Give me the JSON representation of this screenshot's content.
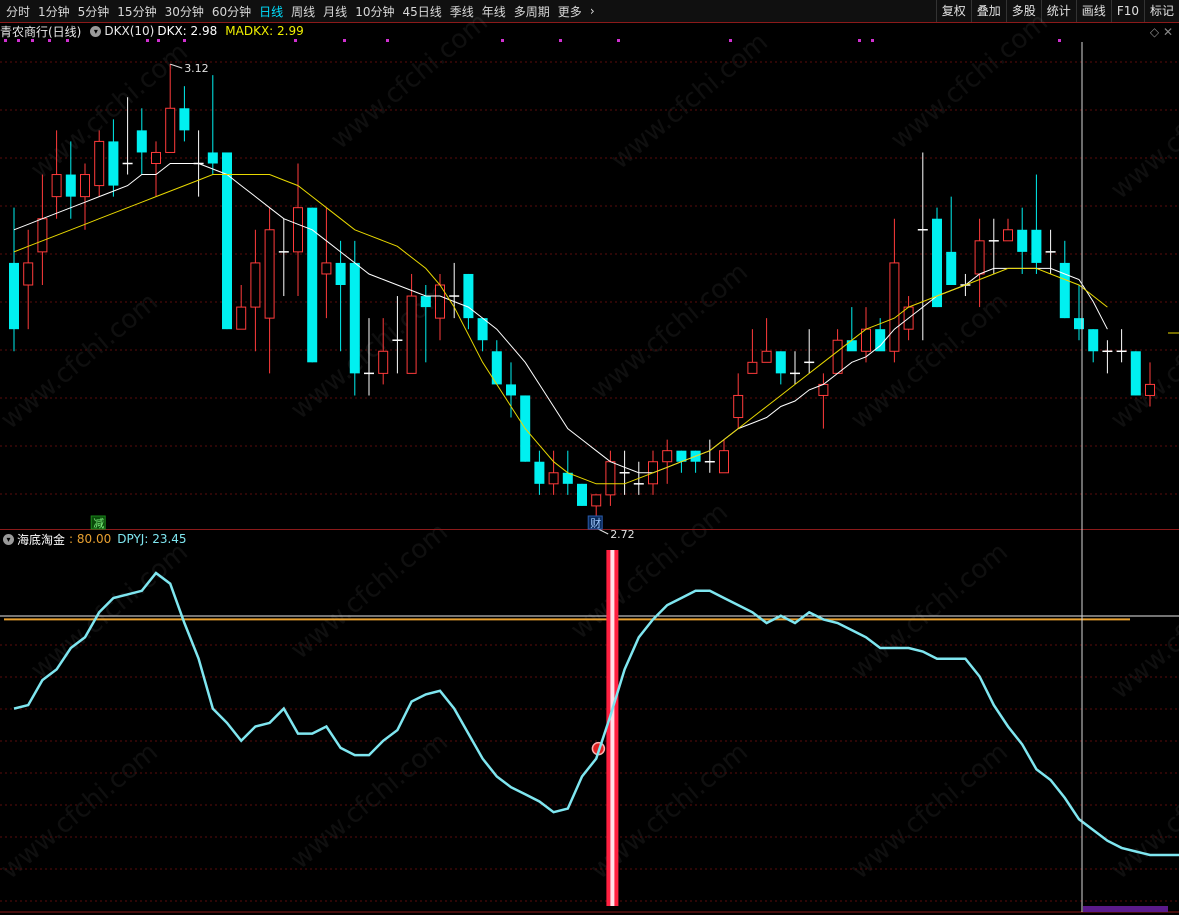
{
  "toolbar": {
    "periods": [
      {
        "label": "分时",
        "active": false
      },
      {
        "label": "1分钟",
        "active": false
      },
      {
        "label": "5分钟",
        "active": false
      },
      {
        "label": "15分钟",
        "active": false
      },
      {
        "label": "30分钟",
        "active": false
      },
      {
        "label": "60分钟",
        "active": false
      },
      {
        "label": "日线",
        "active": true
      },
      {
        "label": "周线",
        "active": false
      },
      {
        "label": "月线",
        "active": false
      },
      {
        "label": "10分钟",
        "active": false
      },
      {
        "label": "45日线",
        "active": false
      },
      {
        "label": "季线",
        "active": false
      },
      {
        "label": "年线",
        "active": false
      },
      {
        "label": "多周期",
        "active": false
      },
      {
        "label": "更多",
        "active": false
      }
    ],
    "more_icon": "chevron-right-icon",
    "right_items": [
      "复权",
      "叠加",
      "多股",
      "统计",
      "画线",
      "F10",
      "标记"
    ]
  },
  "main_panel": {
    "title": "青农商行(日线)",
    "indicator": "DKX(10)",
    "dkx_label": "DKX:",
    "dkx_value": "2.98",
    "madkx_label": "MADKX:",
    "madkx_value": "2.99",
    "high_label": "3.12",
    "low_label": "2.72",
    "marker_jian": "减",
    "marker_cai": "财",
    "colors": {
      "up": "#ff3b3b",
      "down": "#00f0f0",
      "dkx": "#ffffff",
      "madkx": "#e8d800"
    }
  },
  "sub_panel": {
    "title": "海底淘金",
    "level_label": ": 80.00",
    "dpyj_label": "DPYJ:",
    "dpyj_value": "23.45",
    "colors": {
      "line": "#7fe6f0",
      "level": "#e8a030",
      "signal": "#ff2040"
    }
  },
  "watermark": "www.cfchi.com",
  "chart_data": [
    {
      "type": "candlestick",
      "title": "青农商行(日线)",
      "price_range": [
        2.7,
        3.14
      ],
      "candles": [
        {
          "o": 2.94,
          "h": 2.99,
          "l": 2.86,
          "c": 2.88
        },
        {
          "o": 2.92,
          "h": 2.97,
          "l": 2.88,
          "c": 2.94
        },
        {
          "o": 2.95,
          "h": 3.02,
          "l": 2.92,
          "c": 2.98
        },
        {
          "o": 3.0,
          "h": 3.06,
          "l": 2.98,
          "c": 3.02
        },
        {
          "o": 3.02,
          "h": 3.05,
          "l": 2.98,
          "c": 3.0
        },
        {
          "o": 3.0,
          "h": 3.03,
          "l": 2.97,
          "c": 3.02
        },
        {
          "o": 3.01,
          "h": 3.06,
          "l": 3.0,
          "c": 3.05
        },
        {
          "o": 3.05,
          "h": 3.07,
          "l": 3.0,
          "c": 3.01
        },
        {
          "o": 3.03,
          "h": 3.09,
          "l": 3.02,
          "c": 3.03
        },
        {
          "o": 3.06,
          "h": 3.08,
          "l": 3.02,
          "c": 3.04
        },
        {
          "o": 3.03,
          "h": 3.05,
          "l": 3.0,
          "c": 3.04
        },
        {
          "o": 3.04,
          "h": 3.12,
          "l": 3.04,
          "c": 3.08
        },
        {
          "o": 3.08,
          "h": 3.1,
          "l": 3.05,
          "c": 3.06
        },
        {
          "o": 3.03,
          "h": 3.06,
          "l": 3.0,
          "c": 3.03
        },
        {
          "o": 3.04,
          "h": 3.11,
          "l": 3.02,
          "c": 3.03
        },
        {
          "o": 3.04,
          "h": 3.04,
          "l": 2.88,
          "c": 2.88
        },
        {
          "o": 2.88,
          "h": 2.92,
          "l": 2.88,
          "c": 2.9
        },
        {
          "o": 2.9,
          "h": 2.97,
          "l": 2.86,
          "c": 2.94
        },
        {
          "o": 2.89,
          "h": 2.99,
          "l": 2.84,
          "c": 2.97
        },
        {
          "o": 2.95,
          "h": 2.98,
          "l": 2.91,
          "c": 2.95
        },
        {
          "o": 2.95,
          "h": 3.03,
          "l": 2.91,
          "c": 2.99
        },
        {
          "o": 2.99,
          "h": 2.99,
          "l": 2.85,
          "c": 2.85
        },
        {
          "o": 2.93,
          "h": 2.99,
          "l": 2.89,
          "c": 2.94
        },
        {
          "o": 2.94,
          "h": 2.96,
          "l": 2.86,
          "c": 2.92
        },
        {
          "o": 2.94,
          "h": 2.96,
          "l": 2.82,
          "c": 2.84
        },
        {
          "o": 2.84,
          "h": 2.89,
          "l": 2.82,
          "c": 2.84
        },
        {
          "o": 2.84,
          "h": 2.89,
          "l": 2.83,
          "c": 2.86
        },
        {
          "o": 2.87,
          "h": 2.91,
          "l": 2.84,
          "c": 2.87
        },
        {
          "o": 2.84,
          "h": 2.93,
          "l": 2.84,
          "c": 2.91
        },
        {
          "o": 2.91,
          "h": 2.92,
          "l": 2.85,
          "c": 2.9
        },
        {
          "o": 2.89,
          "h": 2.93,
          "l": 2.87,
          "c": 2.92
        },
        {
          "o": 2.91,
          "h": 2.94,
          "l": 2.89,
          "c": 2.91
        },
        {
          "o": 2.93,
          "h": 2.93,
          "l": 2.88,
          "c": 2.89
        },
        {
          "o": 2.89,
          "h": 2.89,
          "l": 2.86,
          "c": 2.87
        },
        {
          "o": 2.86,
          "h": 2.87,
          "l": 2.83,
          "c": 2.83
        },
        {
          "o": 2.83,
          "h": 2.85,
          "l": 2.8,
          "c": 2.82
        },
        {
          "o": 2.82,
          "h": 2.82,
          "l": 2.76,
          "c": 2.76
        },
        {
          "o": 2.76,
          "h": 2.77,
          "l": 2.73,
          "c": 2.74
        },
        {
          "o": 2.74,
          "h": 2.77,
          "l": 2.73,
          "c": 2.75
        },
        {
          "o": 2.75,
          "h": 2.77,
          "l": 2.73,
          "c": 2.74
        },
        {
          "o": 2.74,
          "h": 2.74,
          "l": 2.72,
          "c": 2.72
        },
        {
          "o": 2.72,
          "h": 2.73,
          "l": 2.7,
          "c": 2.73
        },
        {
          "o": 2.73,
          "h": 2.77,
          "l": 2.72,
          "c": 2.76
        },
        {
          "o": 2.75,
          "h": 2.77,
          "l": 2.73,
          "c": 2.75
        },
        {
          "o": 2.74,
          "h": 2.76,
          "l": 2.73,
          "c": 2.74
        },
        {
          "o": 2.74,
          "h": 2.77,
          "l": 2.73,
          "c": 2.76
        },
        {
          "o": 2.76,
          "h": 2.78,
          "l": 2.74,
          "c": 2.77
        },
        {
          "o": 2.77,
          "h": 2.77,
          "l": 2.75,
          "c": 2.76
        },
        {
          "o": 2.77,
          "h": 2.77,
          "l": 2.75,
          "c": 2.76
        },
        {
          "o": 2.76,
          "h": 2.78,
          "l": 2.75,
          "c": 2.76
        },
        {
          "o": 2.75,
          "h": 2.78,
          "l": 2.75,
          "c": 2.77
        },
        {
          "o": 2.8,
          "h": 2.84,
          "l": 2.79,
          "c": 2.82
        },
        {
          "o": 2.84,
          "h": 2.88,
          "l": 2.84,
          "c": 2.85
        },
        {
          "o": 2.85,
          "h": 2.89,
          "l": 2.85,
          "c": 2.86
        },
        {
          "o": 2.86,
          "h": 2.86,
          "l": 2.83,
          "c": 2.84
        },
        {
          "o": 2.84,
          "h": 2.86,
          "l": 2.83,
          "c": 2.84
        },
        {
          "o": 2.85,
          "h": 2.88,
          "l": 2.84,
          "c": 2.85
        },
        {
          "o": 2.82,
          "h": 2.84,
          "l": 2.79,
          "c": 2.83
        },
        {
          "o": 2.84,
          "h": 2.88,
          "l": 2.84,
          "c": 2.87
        },
        {
          "o": 2.87,
          "h": 2.9,
          "l": 2.87,
          "c": 2.86
        },
        {
          "o": 2.86,
          "h": 2.9,
          "l": 2.85,
          "c": 2.88
        },
        {
          "o": 2.88,
          "h": 2.89,
          "l": 2.87,
          "c": 2.86
        },
        {
          "o": 2.86,
          "h": 2.98,
          "l": 2.85,
          "c": 2.94
        },
        {
          "o": 2.88,
          "h": 2.91,
          "l": 2.87,
          "c": 2.9
        },
        {
          "o": 2.97,
          "h": 3.04,
          "l": 2.87,
          "c": 2.97
        },
        {
          "o": 2.98,
          "h": 2.99,
          "l": 2.9,
          "c": 2.9
        },
        {
          "o": 2.95,
          "h": 3.0,
          "l": 2.92,
          "c": 2.92
        },
        {
          "o": 2.92,
          "h": 2.93,
          "l": 2.91,
          "c": 2.92
        },
        {
          "o": 2.93,
          "h": 2.98,
          "l": 2.9,
          "c": 2.96
        },
        {
          "o": 2.96,
          "h": 2.98,
          "l": 2.93,
          "c": 2.96
        },
        {
          "o": 2.96,
          "h": 2.98,
          "l": 2.96,
          "c": 2.97
        },
        {
          "o": 2.97,
          "h": 2.99,
          "l": 2.93,
          "c": 2.95
        },
        {
          "o": 2.97,
          "h": 3.02,
          "l": 2.93,
          "c": 2.94
        },
        {
          "o": 2.95,
          "h": 2.97,
          "l": 2.93,
          "c": 2.95
        },
        {
          "o": 2.94,
          "h": 2.96,
          "l": 2.89,
          "c": 2.89
        },
        {
          "o": 2.89,
          "h": 2.92,
          "l": 2.87,
          "c": 2.88
        },
        {
          "o": 2.88,
          "h": 2.88,
          "l": 2.85,
          "c": 2.86
        },
        {
          "o": 2.86,
          "h": 2.87,
          "l": 2.84,
          "c": 2.86
        },
        {
          "o": 2.86,
          "h": 2.88,
          "l": 2.85,
          "c": 2.86
        },
        {
          "o": 2.86,
          "h": 2.86,
          "l": 2.82,
          "c": 2.82
        },
        {
          "o": 2.82,
          "h": 2.85,
          "l": 2.81,
          "c": 2.83
        }
      ],
      "series": [
        {
          "name": "DKX",
          "values": [
            2.97,
            2.975,
            2.98,
            2.985,
            2.99,
            2.995,
            3.0,
            3.005,
            3.01,
            3.02,
            3.02,
            3.03,
            3.03,
            3.03,
            3.025,
            3.02,
            3.01,
            3.0,
            2.99,
            2.98,
            2.975,
            2.97,
            2.96,
            2.95,
            2.94,
            2.93,
            2.925,
            2.92,
            2.915,
            2.91,
            2.91,
            2.905,
            2.9,
            2.89,
            2.88,
            2.865,
            2.85,
            2.83,
            2.81,
            2.79,
            2.78,
            2.77,
            2.76,
            2.755,
            2.75,
            2.75,
            2.755,
            2.76,
            2.765,
            2.77,
            2.78,
            2.79,
            2.795,
            2.8,
            2.81,
            2.815,
            2.825,
            2.83,
            2.84,
            2.85,
            2.855,
            2.865,
            2.88,
            2.89,
            2.9,
            2.91,
            2.915,
            2.92,
            2.93,
            2.935,
            2.935,
            2.935,
            2.935,
            2.935,
            2.93,
            2.925,
            2.905,
            2.88
          ]
        },
        {
          "name": "MADKX",
          "values": [
            2.95,
            2.955,
            2.96,
            2.965,
            2.97,
            2.975,
            2.98,
            2.985,
            2.99,
            2.995,
            3.0,
            3.005,
            3.01,
            3.015,
            3.02,
            3.02,
            3.02,
            3.02,
            3.02,
            3.015,
            3.01,
            3.0,
            2.99,
            2.98,
            2.97,
            2.965,
            2.96,
            2.955,
            2.945,
            2.935,
            2.92,
            2.9,
            2.875,
            2.85,
            2.83,
            2.81,
            2.79,
            2.775,
            2.76,
            2.75,
            2.745,
            2.74,
            2.74,
            2.74,
            2.745,
            2.75,
            2.755,
            2.76,
            2.765,
            2.77,
            2.78,
            2.79,
            2.8,
            2.81,
            2.82,
            2.83,
            2.84,
            2.85,
            2.86,
            2.87,
            2.88,
            2.885,
            2.89,
            2.9,
            2.905,
            2.91,
            2.915,
            2.92,
            2.925,
            2.93,
            2.935,
            2.935,
            2.935,
            2.93,
            2.925,
            2.92,
            2.91,
            2.9
          ]
        }
      ]
    },
    {
      "type": "line",
      "title": "海底淘金",
      "ylim": [
        0,
        100
      ],
      "level": 80,
      "series": [
        {
          "name": "DPYJ",
          "values": [
            55,
            56,
            63,
            66,
            72,
            75,
            82,
            86,
            87,
            88,
            93,
            90,
            79,
            69,
            55,
            51,
            46,
            50,
            51,
            55,
            48,
            48,
            50,
            44,
            42,
            42,
            46,
            49,
            57,
            59,
            60,
            55,
            48,
            41,
            36,
            33,
            31,
            29,
            26,
            27,
            36,
            41,
            53,
            66,
            75,
            80,
            84,
            86,
            88,
            88,
            86,
            84,
            82,
            79,
            81,
            79,
            82,
            80,
            79,
            77,
            75,
            72,
            72,
            72,
            71,
            69,
            69,
            69,
            64,
            56,
            50,
            45,
            38,
            35,
            30,
            24,
            21,
            18,
            16,
            15,
            14,
            14,
            14,
            14
          ]
        }
      ],
      "signals": [
        {
          "index": 42
        }
      ]
    }
  ]
}
